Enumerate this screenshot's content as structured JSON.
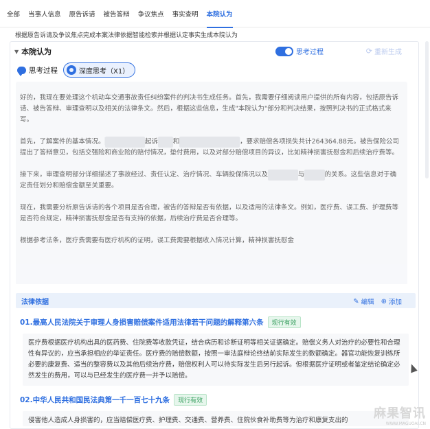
{
  "tabs": [
    {
      "label": "全部"
    },
    {
      "label": "当事人信息"
    },
    {
      "label": "原告诉请"
    },
    {
      "label": "被告答辩"
    },
    {
      "label": "争议焦点"
    },
    {
      "label": "事实查明"
    },
    {
      "label": "本院认为"
    }
  ],
  "active_tab": "本院认为",
  "subtitle": "根据原告诉请及争议焦点完成本案法律依据智能检索并根据认定事实生成本院认为",
  "card": {
    "title": "本院认为",
    "toggle_label": "思考过程",
    "toggle_on": true,
    "regenerate_label": "重新生成",
    "think_label": "思考过程",
    "deep_think_label": "深度思考（X1）"
  },
  "thinking": {
    "p1": "好的，我现在要处理这个机动车交通事故责任纠纷案件的判决书生成任务。首先，我需要仔细阅读用户提供的所有内容，包括原告诉请、被告答辩、审理查明以及相关的法律条文。然后，根据这些信息，生成\"本院认为\"部分和判决结果，按照判决书的正式格式来写。",
    "p2a": "首先，了解案件的基本情况。",
    "p2b": "起诉",
    "p2c": "和",
    "p2d": "，要求赔偿各项损失共计264364.88元。被告保险公司提出了答辩意见，包括交强险和商业险的赔付情况，垫付费用，以及对部分赔偿项目的异议，比如精神损害抚慰金和后续治疗费等。",
    "p3a": "接下来，审理查明部分详细描述了事故经过、责任认定、治疗情况、车辆投保情况以及",
    "p3b": "与",
    "p3c": "的关系。这些信息对于确定责任划分和赔偿金额至关重要。",
    "p4": "现在，我需要分析原告诉请的各个项目是否合理，被告的答辩是否有依据，以及适用的法律条文。例如，医疗费、误工费、护理费等是否符合规定，精神损害抚慰金是否有支持的依据，后续治疗费是否合理等。",
    "p5": "根据参考法条，医疗费需要有医疗机构的证明，误工费需要根据收入情况计算，精神损害抚慰金"
  },
  "law": {
    "title": "法律依据",
    "edit_label": "编辑",
    "add_label": "添加",
    "items": [
      {
        "title": "01.最高人民法院关于审理人身损害赔偿案件适用法律若干问题的解释第六条",
        "badge": "现行有效",
        "body": "医疗费根据医疗机构出具的医药费、住院费等收款凭证，结合病历和诊断证明等相关证据确定。赔偿义务人对治疗的必要性和合理性有异议的，应当承担相应的举证责任。医疗费的赔偿数额，按照一审法庭辩论终结前实际发生的数额确定。器官功能恢复训练所必要的康复费、适当的整容费以及其他后续治疗费，赔偿权利人可以待实际发生后另行起诉。但根据医疗证明或者鉴定结论确定必然发生的费用，可以与已经发生的医疗费一并予以赔偿。"
      },
      {
        "title": "02.中华人民共和国民法典第一千一百七十九条",
        "badge": "现行有效",
        "body": "侵害他人造成人身损害的，应当赔偿医疗费、护理费、交通费、营养费、住院伙食补助费等为治疗和康复支出的"
      }
    ]
  },
  "watermark": {
    "big": "麻果智讯",
    "small": "WWW.MAGUOAI.CN"
  }
}
